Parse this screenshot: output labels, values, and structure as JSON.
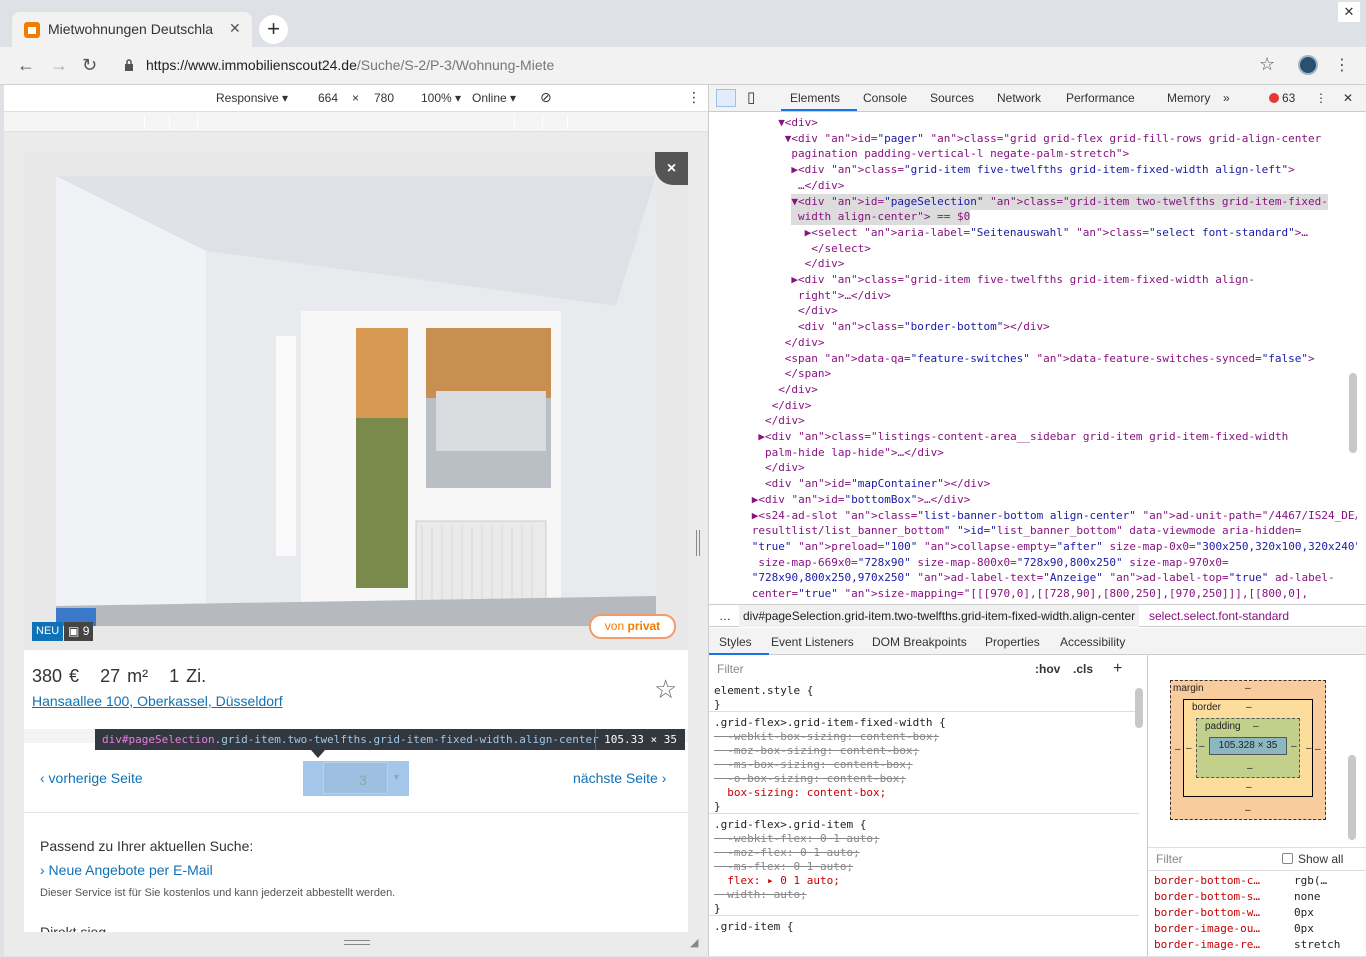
{
  "browser": {
    "tab_title": "Mietwohnungen Deutschla",
    "tab_close": "✕",
    "new_tab": "+",
    "window_close": "✕",
    "url_host": "https://www.immobilienscout24.de",
    "url_path": "/Suche/S-2/P-3/Wohnung-Miete",
    "icons": [
      "back-icon",
      "forward-icon",
      "reload-icon",
      "lock-icon",
      "star-icon",
      "profile-avatar",
      "kebab-menu-icon"
    ]
  },
  "device_toolbar": {
    "mode": "Responsive ▾",
    "width": "664",
    "times": "×",
    "height": "780",
    "zoom": "100% ▾",
    "throttle": "Online ▾"
  },
  "listing": {
    "close": "×",
    "badge_new": "NEU",
    "image_count": "9",
    "privat_prefix": "von",
    "privat_label": "privat",
    "price": "380 €",
    "size": "27 m²",
    "rooms": "1 Zi.",
    "address": "Hansaallee 100, Oberkassel, Düsseldorf",
    "favorite": "☆"
  },
  "pagination": {
    "prev": "‹ vorherige Seite",
    "next": "nächste Seite ›",
    "current_page": "3",
    "dropdown_arrow": "▾"
  },
  "tooltip": {
    "tag": "div",
    "id": "#pageSelection",
    "classes": ".grid-item.two-twelfths.grid-item-fixed-width.align-center",
    "dims": "105.33 × 35"
  },
  "promo": {
    "heading": "Passend zu Ihrer aktuellen Suche:",
    "link": "› Neue Angebote per E-Mail",
    "note": "Dieser Service ist für Sie kostenlos und kann jederzeit abbestellt werden.",
    "cut_text": "Direkt sieg..."
  },
  "devtools": {
    "tabs": [
      "Elements",
      "Console",
      "Sources",
      "Network",
      "Performance",
      "Memory",
      "»"
    ],
    "error_count": "63",
    "close": "✕",
    "dom_lines": [
      {
        "indent": "            ",
        "html": "▼<div>"
      },
      {
        "indent": "             ",
        "html": "▼<div id=\"pager\" class=\"grid grid-flex grid-fill-rows grid-align-center"
      },
      {
        "indent": "             ",
        "html": " pagination padding-vertical-l negate-palm-stretch\">"
      },
      {
        "indent": "              ",
        "html": "▶<div class=\"grid-item five-twelfths grid-item-fixed-width align-left\">"
      },
      {
        "indent": "              ",
        "html": " …</div>"
      },
      {
        "indent": "              ",
        "html": "▼<div id=\"pageSelection\" class=\"grid-item two-twelfths grid-item-fixed-"
      },
      {
        "indent": "              ",
        "html": " width align-center\"> == $0"
      },
      {
        "indent": "                ",
        "html": "▶<select aria-label=\"Seitenauswahl\" class=\"select font-standard\">…"
      },
      {
        "indent": "                ",
        "html": " </select>"
      },
      {
        "indent": "                ",
        "html": "</div>"
      },
      {
        "indent": "              ",
        "html": "▶<div class=\"grid-item five-twelfths grid-item-fixed-width align-"
      },
      {
        "indent": "              ",
        "html": " right\">…</div>"
      },
      {
        "indent": "              ",
        "html": " </div>"
      },
      {
        "indent": "              ",
        "html": " <div class=\"border-bottom\"></div>"
      },
      {
        "indent": "             ",
        "html": "</div>"
      },
      {
        "indent": "             ",
        "html": "<span data-qa=\"feature-switches\" data-feature-switches-synced=\"false\">"
      },
      {
        "indent": "             ",
        "html": "</span>"
      },
      {
        "indent": "            ",
        "html": "</div>"
      },
      {
        "indent": "           ",
        "html": "</div>"
      },
      {
        "indent": "          ",
        "html": "</div>"
      },
      {
        "indent": "         ",
        "html": "▶<div class=\"listings-content-area__sidebar grid-item grid-item-fixed-width"
      },
      {
        "indent": "         ",
        "html": " palm-hide lap-hide\">…</div>"
      },
      {
        "indent": "         ",
        "html": " </div>"
      },
      {
        "indent": "         ",
        "html": " <div id=\"mapContainer\"></div>"
      },
      {
        "indent": "        ",
        "html": "▶<div id=\"bottomBox\">…</div>"
      },
      {
        "indent": "        ",
        "html": "▶<s24-ad-slot class=\"list-banner-bottom align-center\" ad-unit-path=\"/4467/IS24_DE/"
      },
      {
        "indent": "        ",
        "html": "resultlist/list_banner_bottom\" id=\"list_banner_bottom\" data-viewmode aria-hidden="
      },
      {
        "indent": "        ",
        "html": "\"true\" preload=\"100\" collapse-empty=\"after\" size-map-0x0=\"300x250,320x100,320x240\""
      },
      {
        "indent": "        ",
        "html": " size-map-669x0=\"728x90\" size-map-800x0=\"728x90,800x250\" size-map-970x0="
      },
      {
        "indent": "        ",
        "html": "\"728x90,800x250,970x250\" ad-label-text=\"Anzeige\" ad-label-top=\"true\" ad-label-"
      },
      {
        "indent": "        ",
        "html": "center=\"true\" size-mapping=\"[[[970,0],[[728,90],[800,250],[970,250]]],[[800,0],"
      }
    ],
    "breadcrumbs": {
      "ellipsis": "…",
      "node": "div#pageSelection.grid-item.two-twelfths.grid-item-fixed-width.align-center",
      "child": "select.select.font-standard"
    },
    "style_tabs": [
      "Styles",
      "Event Listeners",
      "DOM Breakpoints",
      "Properties",
      "Accessibility"
    ],
    "filter_placeholder": "Filter",
    "hov": ":hov",
    "cls": ".cls",
    "add": "+",
    "style_lines": [
      {
        "t": "element.style {",
        "k": "sel"
      },
      {
        "t": "}",
        "k": "plain"
      },
      {
        "t": ".grid-flex>.grid-item-fixed-width {",
        "k": "sel"
      },
      {
        "t": "  -webkit-box-sizing: content-box;",
        "k": "strike"
      },
      {
        "t": "  -moz-box-sizing: content-box;",
        "k": "strike"
      },
      {
        "t": "  -ms-box-sizing: content-box;",
        "k": "strike"
      },
      {
        "t": "  -o-box-sizing: content-box;",
        "k": "strike"
      },
      {
        "t": "  box-sizing: content-box;",
        "k": "prop"
      },
      {
        "t": "}",
        "k": "plain"
      },
      {
        "t": ".grid-flex>.grid-item {",
        "k": "sel"
      },
      {
        "t": "  -webkit-flex: 0 1 auto;",
        "k": "strike"
      },
      {
        "t": "  -moz-flex: 0 1 auto;",
        "k": "strike"
      },
      {
        "t": "  -ms-flex: 0 1 auto;",
        "k": "strike"
      },
      {
        "t": "  flex: ▸ 0 1 auto;",
        "k": "prop"
      },
      {
        "t": "  width: auto;",
        "k": "strike"
      },
      {
        "t": "}",
        "k": "plain"
      },
      {
        "t": ".grid-item {",
        "k": "sel"
      }
    ],
    "box_model": {
      "margin_label": "margin",
      "border_label": "border",
      "padding_label": "padding",
      "content": "105.328 × 35",
      "dash": "–"
    },
    "computed_filter": "Filter",
    "show_all": "Show all",
    "computed": [
      {
        "prop": "border-bottom-c…",
        "val": "rgb(…"
      },
      {
        "prop": "border-bottom-s…",
        "val": "none"
      },
      {
        "prop": "border-bottom-w…",
        "val": "0px"
      },
      {
        "prop": "border-image-ou…",
        "val": "0px"
      },
      {
        "prop": "border-image-re…",
        "val": "stretch"
      }
    ]
  }
}
